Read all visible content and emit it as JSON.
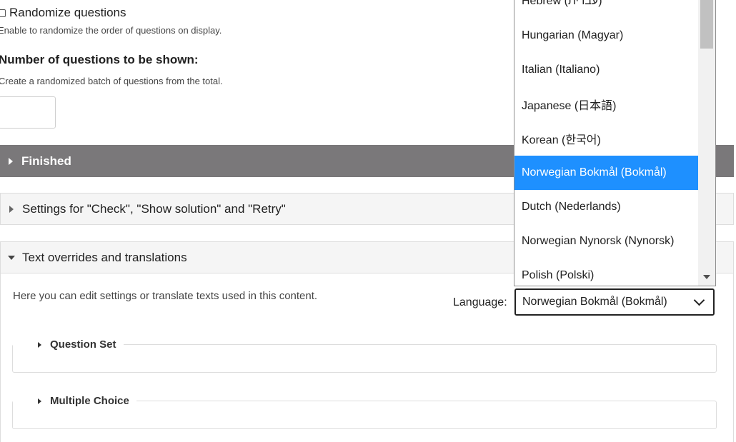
{
  "settings": {
    "randomize_label": "Randomize questions",
    "randomize_desc": "Enable to randomize the order of questions on display.",
    "num_questions_label": "Number of questions to be shown:",
    "num_questions_desc": "Create a randomized batch of questions from the total.",
    "num_questions_value": ""
  },
  "groups": {
    "finished": "Finished",
    "check_settings": "Settings for \"Check\", \"Show solution\" and \"Retry\"",
    "overrides": "Text overrides and translations"
  },
  "overrides": {
    "help": "Here you can edit settings or translate texts used in this content.",
    "language_label": "Language:",
    "language_value": "Norwegian Bokmål (Bokmål)",
    "sub_groups": [
      "Question Set",
      "Multiple Choice"
    ]
  },
  "dropdown": {
    "items": [
      "Hebrew (עברית)",
      "Hungarian (Magyar)",
      "Italian (Italiano)",
      "Japanese (日本語)",
      "Korean (한국어)",
      "Norwegian Bokmål (Bokmål)",
      "Dutch (Nederlands)",
      "Norwegian Nynorsk (Nynorsk)",
      "Polish (Polski)"
    ],
    "selected_index": 5
  },
  "colors": {
    "finished_bg": "#7a787a",
    "selected_bg": "#1e90ff"
  }
}
